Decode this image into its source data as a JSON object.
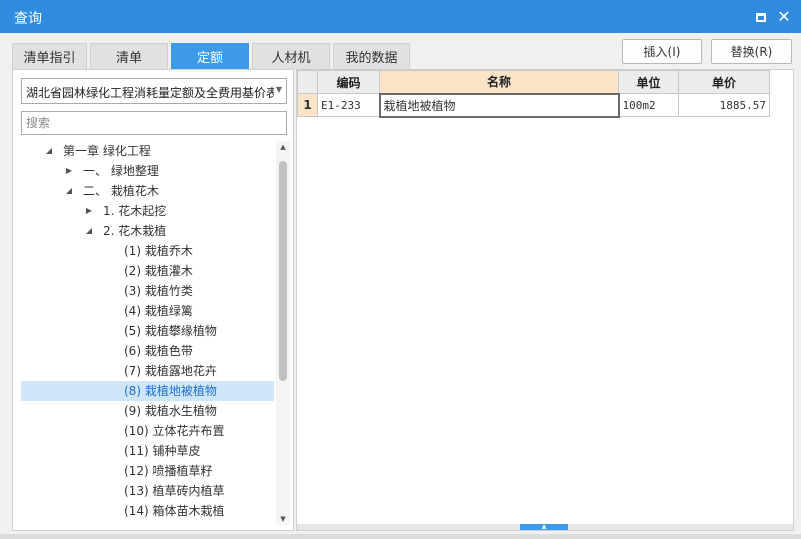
{
  "window": {
    "title": "查询"
  },
  "tabs": [
    {
      "label": "清单指引",
      "active": false
    },
    {
      "label": "清单",
      "active": false
    },
    {
      "label": "定额",
      "active": true
    },
    {
      "label": "人材机",
      "active": false
    },
    {
      "label": "我的数据",
      "active": false
    }
  ],
  "actions": {
    "insert_label": "插入(I)",
    "replace_label": "替换(R)"
  },
  "library_select": {
    "value": "湖北省园林绿化工程消耗量定额及全费用基价表"
  },
  "search": {
    "placeholder": "搜索",
    "value": ""
  },
  "tree": [
    {
      "label": "第一章 绿化工程",
      "level": 0,
      "toggle": "expanded"
    },
    {
      "label": "一、 绿地整理",
      "level": 1,
      "toggle": "collapsed"
    },
    {
      "label": "二、 栽植花木",
      "level": 1,
      "toggle": "expanded"
    },
    {
      "label": "1. 花木起挖",
      "level": 2,
      "toggle": "collapsed"
    },
    {
      "label": "2. 花木栽植",
      "level": 2,
      "toggle": "expanded"
    },
    {
      "label": "(1) 栽植乔木",
      "level": 3,
      "toggle": "none"
    },
    {
      "label": "(2) 栽植灌木",
      "level": 3,
      "toggle": "none"
    },
    {
      "label": "(3) 栽植竹类",
      "level": 3,
      "toggle": "none"
    },
    {
      "label": "(4) 栽植绿篱",
      "level": 3,
      "toggle": "none"
    },
    {
      "label": "(5) 栽植攀缘植物",
      "level": 3,
      "toggle": "none"
    },
    {
      "label": "(6) 栽植色带",
      "level": 3,
      "toggle": "none"
    },
    {
      "label": "(7) 栽植露地花卉",
      "level": 3,
      "toggle": "none"
    },
    {
      "label": "(8) 栽植地被植物",
      "level": 3,
      "toggle": "none",
      "selected": true
    },
    {
      "label": "(9) 栽植水生植物",
      "level": 3,
      "toggle": "none"
    },
    {
      "label": "(10) 立体花卉布置",
      "level": 3,
      "toggle": "none"
    },
    {
      "label": "(11) 铺种草皮",
      "level": 3,
      "toggle": "none"
    },
    {
      "label": "(12) 喷播植草籽",
      "level": 3,
      "toggle": "none"
    },
    {
      "label": "(13) 植草砖内植草",
      "level": 3,
      "toggle": "none"
    },
    {
      "label": "(14) 箱体苗木栽植",
      "level": 3,
      "toggle": "none"
    }
  ],
  "grid": {
    "columns": [
      "编码",
      "名称",
      "单位",
      "单价"
    ],
    "rows": [
      {
        "num": "1",
        "code": "E1-233",
        "name": "栽植地被植物",
        "unit": "100m2",
        "price": "1885.57"
      }
    ]
  },
  "icons": {
    "maximize": "maximize-icon",
    "close": "close-icon",
    "dropdown": "chevron-down-icon",
    "expanded": "triangle-down-icon",
    "collapsed": "triangle-right-icon"
  },
  "colors": {
    "titlebar": "#2f8ce0",
    "active_tab": "#3c9ae8",
    "selected_row": "#cde6fa",
    "header_highlight": "#fbe3c8"
  }
}
